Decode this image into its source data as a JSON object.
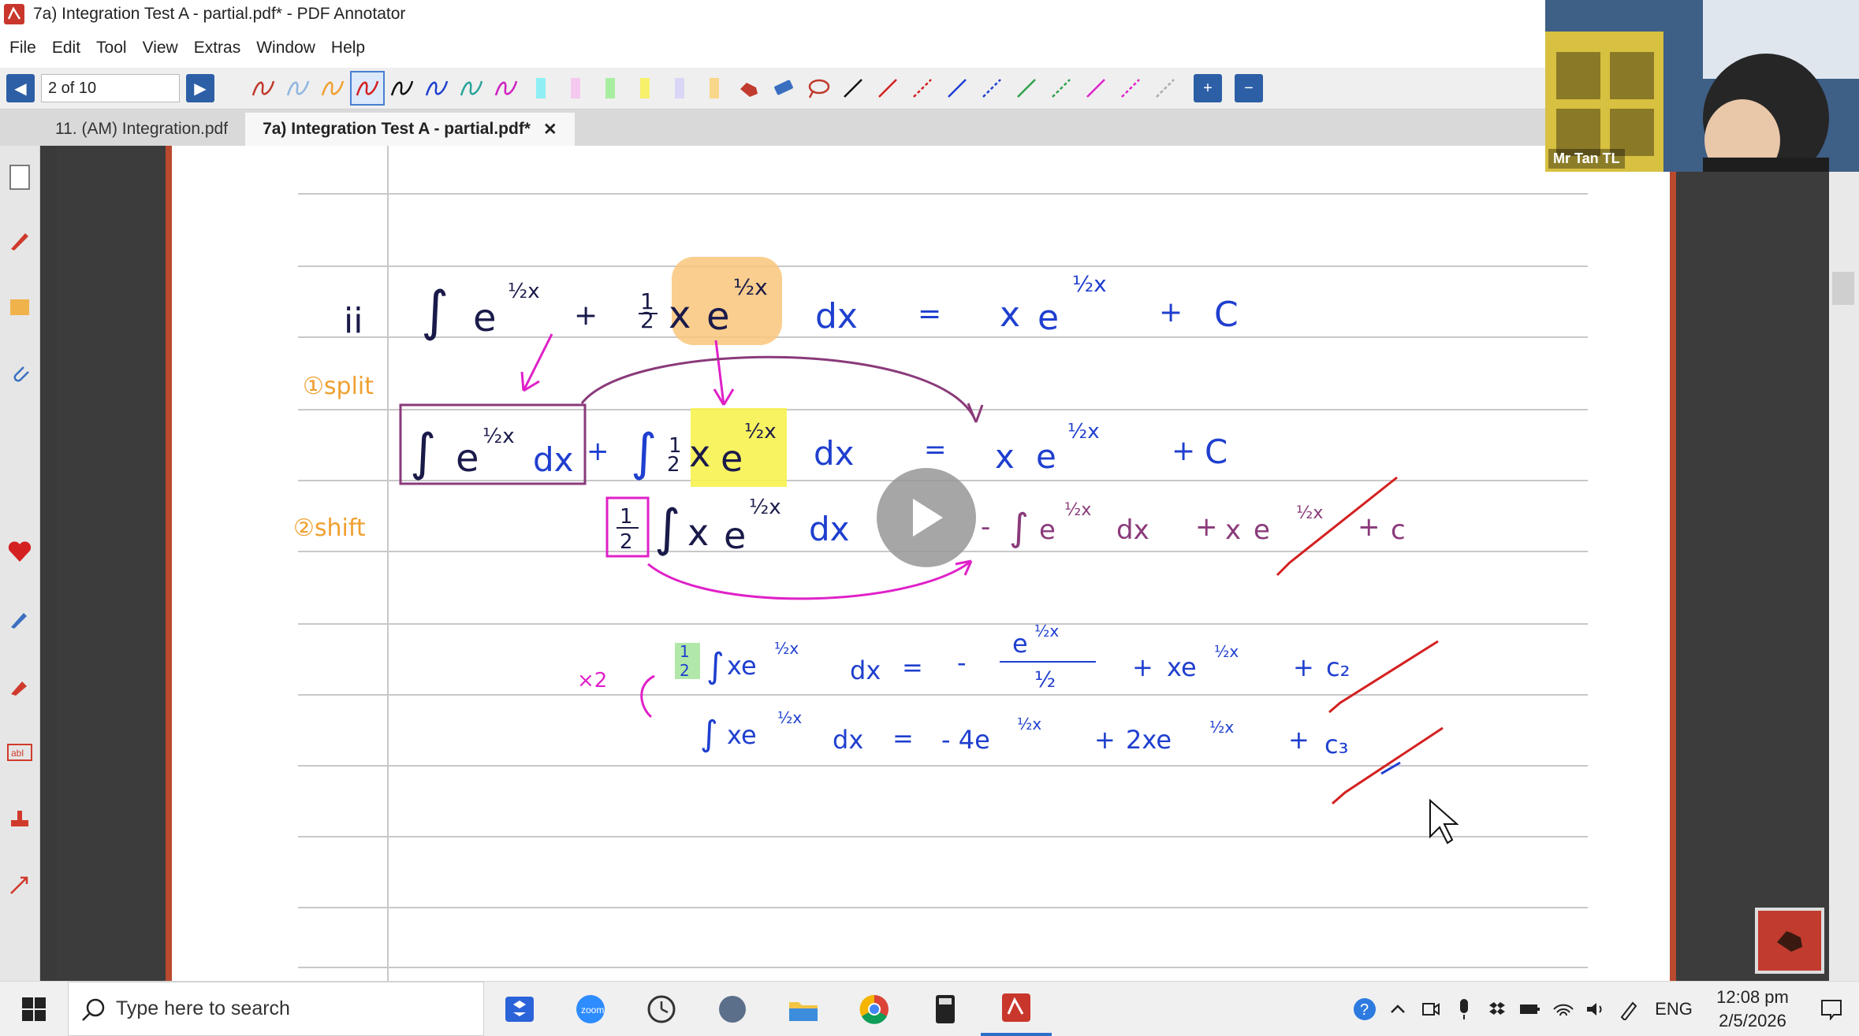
{
  "window": {
    "title": "7a) Integration Test A - partial.pdf* - PDF Annotator"
  },
  "menu": [
    "File",
    "Edit",
    "Tool",
    "View",
    "Extras",
    "Window",
    "Help"
  ],
  "navigation": {
    "page_indicator": "2 of 10"
  },
  "tabs": [
    {
      "label": "11. (AM) Integration.pdf",
      "active": false
    },
    {
      "label": "7a) Integration Test A - partial.pdf*",
      "active": true
    }
  ],
  "tab_close": "✕",
  "webcam": {
    "name": "Mr Tan TL"
  },
  "taskbar": {
    "search_placeholder": "Type here to search",
    "language": "ENG",
    "time": "12:08 pm",
    "date": "2/5/2026"
  },
  "handwriting": {
    "part_label": "ii",
    "step1": "①split",
    "step2": "②shift",
    "line1": {
      "integral": "∫ e^(½x) + ½ x e^(½x) dx",
      "eq": "=",
      "rhs": "x e^(½x) + C"
    },
    "line2": {
      "lhs": "∫ e^(½x) dx + ∫ ½ x e^(½x) dx",
      "eq": "=",
      "rhs": "x e^(½x) + C"
    },
    "line3": {
      "lhs": "½ ∫ x e^(½x) dx",
      "eq": "=",
      "rhs": "- ∫ e^(½x) dx + x e^(½x) + c"
    },
    "line4": {
      "mult": "×2",
      "lhs": "½ ∫ x e^(½x) dx",
      "eq": "=",
      "rhs": "- e^(½x) / ½ + x e^(½x) + c₂"
    },
    "line5": {
      "lhs": "∫ x e^(½x) dx",
      "eq": "=",
      "rhs": "- 4e^(½x) + 2x e^(½x) + c₃"
    }
  },
  "colors": {
    "toolbar_blue": "#2d5fa6",
    "page_border": "#b94a2f",
    "ink_blue": "#1f3fcf",
    "ink_magenta": "#e020c8",
    "ink_orange": "#f0a030",
    "ink_purple": "#8a3a7a",
    "ink_red": "#d42020",
    "highlight_orange": "#f9c57a",
    "highlight_yellow": "#f7f250",
    "highlight_green": "#a8e6a0"
  }
}
